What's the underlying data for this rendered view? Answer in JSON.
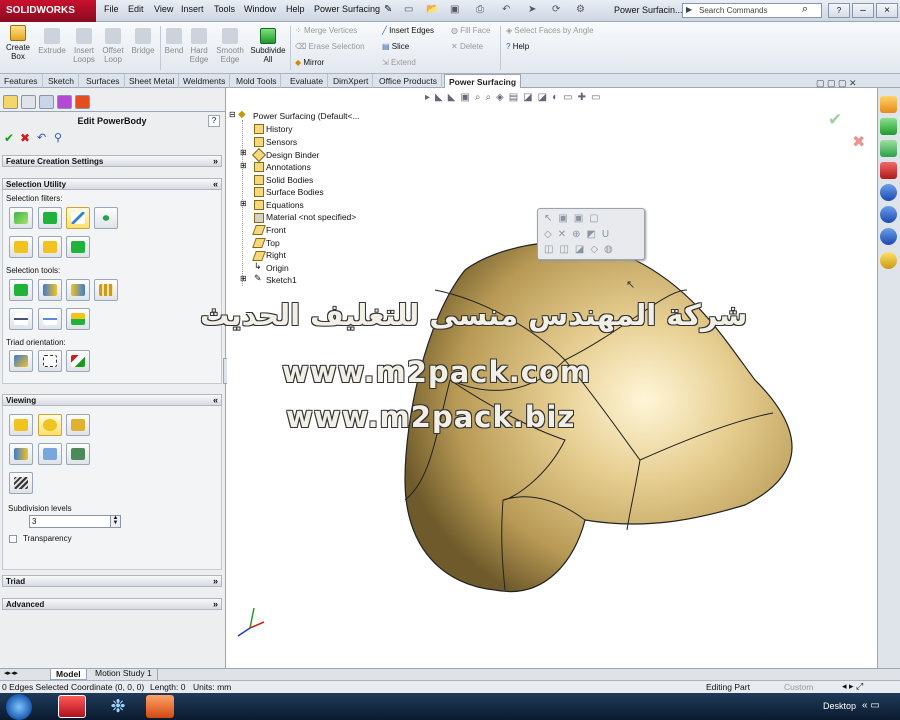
{
  "app": {
    "brand": "SOLIDWORKS",
    "document_title": "Power Surfacin...",
    "search_placeholder": "Search Commands"
  },
  "menu": [
    "File",
    "Edit",
    "View",
    "Insert",
    "Tools",
    "Window",
    "Help",
    "Power Surfacing"
  ],
  "ribbon": {
    "create_box": "Create Box",
    "extrude": "Extrude",
    "insert_loops": "Insert Loops",
    "offset_loop": "Offset Loop",
    "bridge": "Bridge",
    "bend": "Bend",
    "hard_edge": "Hard Edge",
    "smooth_edge": "Smooth Edge",
    "subdivide_all": "Subdivide All",
    "merge_vertices": "Merge Vertices",
    "erase_selection": "Erase Selection",
    "mirror": "Mirror",
    "insert_edges": "Insert Edges",
    "slice": "Slice",
    "extend": "Extend",
    "fill_face": "Fill Face",
    "delete": "Delete",
    "select_faces_by_angle": "Select Faces by Angle",
    "help": "Help"
  },
  "tabs": [
    "Features",
    "Sketch",
    "Surfaces",
    "Sheet Metal",
    "Weldments",
    "Mold Tools",
    "Evaluate",
    "DimXpert",
    "Office Products",
    "Power Surfacing"
  ],
  "property_manager": {
    "title": "Edit PowerBody",
    "help_glyph": "?",
    "feature_creation": "Feature Creation Settings",
    "selection_utility": "Selection Utility",
    "selection_filters": "Selection filters:",
    "selection_tools": "Selection tools:",
    "triad_orientation": "Triad orientation:",
    "viewing": "Viewing",
    "subdivision_levels": "Subdivision levels",
    "subdivision_value": "3",
    "transparency": "Transparency",
    "triad": "Triad",
    "advanced": "Advanced"
  },
  "tree": {
    "root": "Power Surfacing  (Default<...",
    "items": [
      "History",
      "Sensors",
      "Design Binder",
      "Annotations",
      "Solid Bodies",
      "Surface Bodies",
      "Equations",
      "Material <not specified>",
      "Front",
      "Top",
      "Right",
      "Origin",
      "Sketch1"
    ]
  },
  "watermark": {
    "arabic": "شركة المهندس منسى للتغليف الحديث",
    "url1": "www.m2pack.com",
    "url2": "www.m2pack.biz"
  },
  "bottom_tabs": [
    "Model",
    "Motion Study 1"
  ],
  "status": {
    "edges": "0 Edges Selected",
    "coordinate": "Coordinate (0, 0, 0)",
    "length": "Length: 0",
    "units": "Units: mm",
    "mode": "Editing Part",
    "custom": "Custom"
  },
  "taskbar": {
    "desktop": "Desktop"
  },
  "colors": {
    "accent": "#c8102e",
    "body": "#c8a75a"
  }
}
